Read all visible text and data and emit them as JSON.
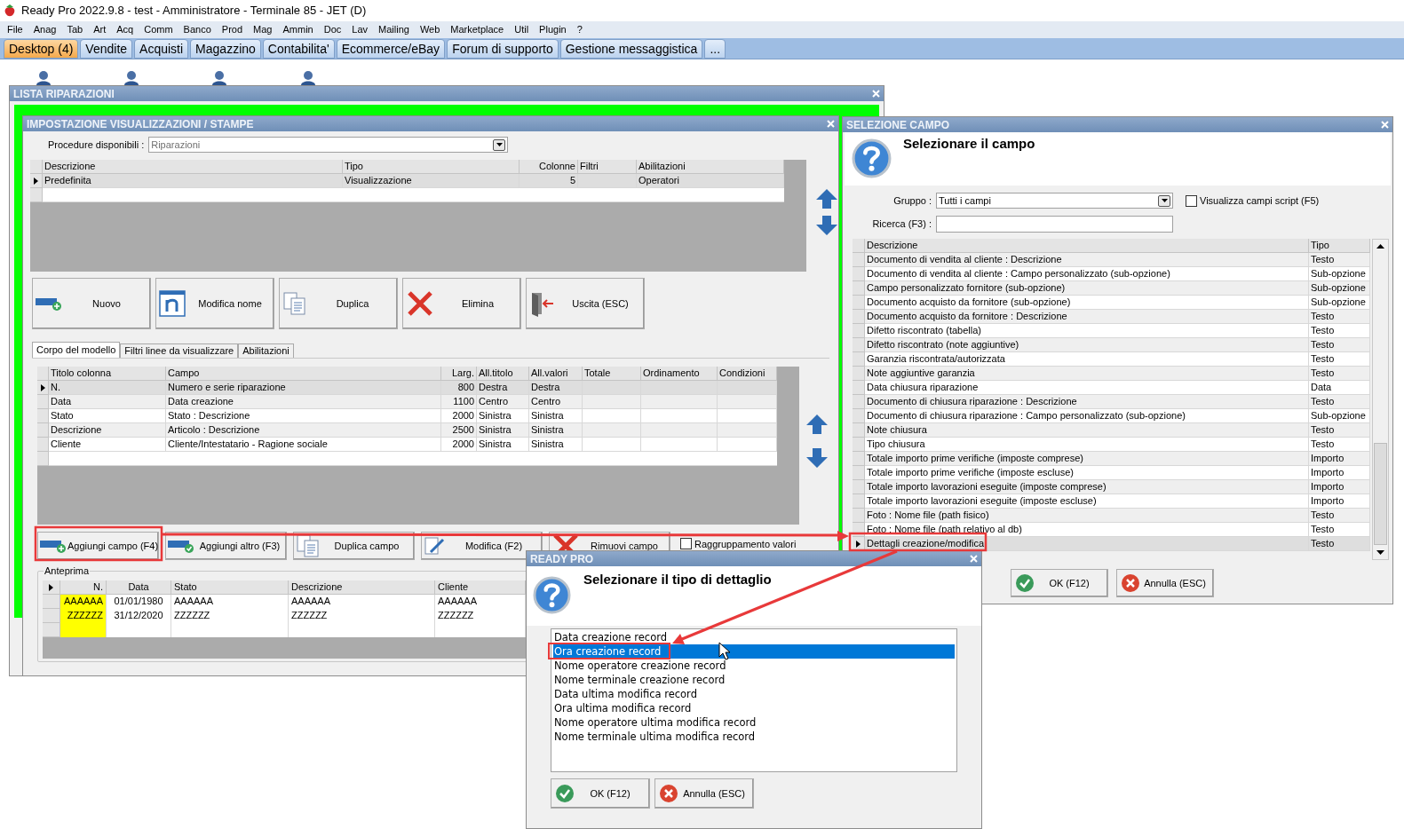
{
  "app": {
    "title": "Ready Pro 2022.9.8 - test - Amministratore - Terminale 85 - JET (D)"
  },
  "menu": [
    "File",
    "Anag",
    "Tab",
    "Art",
    "Acq",
    "Comm",
    "Banco",
    "Prod",
    "Mag",
    "Ammin",
    "Doc",
    "Lav",
    "Mailing",
    "Web",
    "Marketplace",
    "Util",
    "Plugin",
    "?"
  ],
  "tabs": [
    {
      "label": "Desktop (4)",
      "selected": true
    },
    {
      "label": "Vendite",
      "selected": false
    },
    {
      "label": "Acquisti",
      "selected": false
    },
    {
      "label": "Magazzino",
      "selected": false
    },
    {
      "label": "Contabilita'",
      "selected": false
    },
    {
      "label": "Ecommerce/eBay",
      "selected": false
    },
    {
      "label": "Forum di supporto",
      "selected": false
    },
    {
      "label": "Gestione messaggistica",
      "selected": false
    },
    {
      "label": "...",
      "selected": false
    }
  ],
  "lista_window": {
    "title": "LISTA RIPARAZIONI"
  },
  "impostazione": {
    "title": "IMPOSTAZIONE VISUALIZZAZIONI / STAMPE",
    "procedure_label": "Procedure disponibili :",
    "procedure_value": "Riparazioni",
    "models": {
      "columns": [
        "Descrizione",
        "Tipo",
        "Colonne",
        "Filtri",
        "Abilitazioni"
      ],
      "rows": [
        {
          "selected": true,
          "cells": [
            "Predefinita",
            "Visualizzazione",
            "5",
            "",
            "Operatori"
          ]
        }
      ]
    },
    "buttons": [
      {
        "kind": "new",
        "label": "Nuovo"
      },
      {
        "kind": "rename",
        "label": "Modifica nome"
      },
      {
        "kind": "duplicate",
        "label": "Duplica"
      },
      {
        "kind": "delete",
        "label": "Elimina"
      },
      {
        "kind": "exit",
        "label": "Uscita (ESC)"
      }
    ],
    "tabs": [
      {
        "label": "Corpo del modello",
        "selected": true
      },
      {
        "label": "Filtri linee da visualizzare",
        "selected": false
      },
      {
        "label": "Abilitazioni",
        "selected": false
      }
    ],
    "fields": {
      "columns": [
        "Titolo colonna",
        "Campo",
        "Larg.",
        "All.titolo",
        "All.valori",
        "Totale",
        "Ordinamento",
        "Condizioni"
      ],
      "rows": [
        {
          "selected": true,
          "cells": [
            "N.",
            "Numero e serie riparazione",
            "800",
            "Destra",
            "Destra",
            "",
            "",
            ""
          ]
        },
        {
          "selected": false,
          "cells": [
            "Data",
            "Data creazione",
            "1100",
            "Centro",
            "Centro",
            "",
            "",
            ""
          ]
        },
        {
          "selected": false,
          "cells": [
            "Stato",
            "Stato : Descrizione",
            "2000",
            "Sinistra",
            "Sinistra",
            "",
            "",
            ""
          ]
        },
        {
          "selected": false,
          "cells": [
            "Descrizione",
            "Articolo : Descrizione",
            "2500",
            "Sinistra",
            "Sinistra",
            "",
            "",
            ""
          ]
        },
        {
          "selected": false,
          "cells": [
            "Cliente",
            "Cliente/Intestatario - Ragione sociale",
            "2000",
            "Sinistra",
            "Sinistra",
            "",
            "",
            ""
          ]
        }
      ]
    },
    "field_buttons": [
      {
        "kind": "add",
        "label": "Aggiungi campo (F4)"
      },
      {
        "kind": "add_other",
        "label": "Aggiungi altro (F3)"
      },
      {
        "kind": "duplicate",
        "label": "Duplica campo"
      },
      {
        "kind": "edit",
        "label": "Modifica (F2)"
      },
      {
        "kind": "remove",
        "label": "Rimuovi campo"
      }
    ],
    "grouping": {
      "label": "Raggruppamento valori",
      "checked": false
    },
    "preview": {
      "title": "Anteprima",
      "columns": [
        "N.",
        "Data",
        "Stato",
        "Descrizione",
        "Cliente"
      ],
      "rows": [
        [
          "AAAAAA",
          "01/01/1980",
          "AAAAAA",
          "AAAAAA",
          "AAAAAA"
        ],
        [
          "ZZZZZZ",
          "31/12/2020",
          "ZZZZZZ",
          "ZZZZZZ",
          "ZZZZZZ"
        ]
      ]
    }
  },
  "selezione": {
    "title": "SELEZIONE CAMPO",
    "heading": "Selezionare il campo",
    "group_label": "Gruppo :",
    "group_value": "Tutti i campi",
    "script": {
      "label": "Visualizza campi script (F5)",
      "checked": false
    },
    "search_label": "Ricerca (F3) :",
    "columns": [
      "Descrizione",
      "Tipo"
    ],
    "rows": [
      {
        "selected": false,
        "descrizione": "Documento di vendita al cliente : Descrizione",
        "tipo": "Testo"
      },
      {
        "selected": false,
        "descrizione": "Documento di vendita al cliente : Campo personalizzato (sub-opzione)",
        "tipo": "Sub-opzione"
      },
      {
        "selected": false,
        "descrizione": "Campo personalizzato fornitore (sub-opzione)",
        "tipo": "Sub-opzione"
      },
      {
        "selected": false,
        "descrizione": "Documento acquisto da fornitore (sub-opzione)",
        "tipo": "Sub-opzione"
      },
      {
        "selected": false,
        "descrizione": "Documento acquisto da fornitore : Descrizione",
        "tipo": "Testo"
      },
      {
        "selected": false,
        "descrizione": "Difetto riscontrato (tabella)",
        "tipo": "Testo"
      },
      {
        "selected": false,
        "descrizione": "Difetto riscontrato (note aggiuntive)",
        "tipo": "Testo"
      },
      {
        "selected": false,
        "descrizione": "Garanzia riscontrata/autorizzata",
        "tipo": "Testo"
      },
      {
        "selected": false,
        "descrizione": "Note aggiuntive garanzia",
        "tipo": "Testo"
      },
      {
        "selected": false,
        "descrizione": "Data chiusura riparazione",
        "tipo": "Data"
      },
      {
        "selected": false,
        "descrizione": "Documento di chiusura riparazione : Descrizione",
        "tipo": "Testo"
      },
      {
        "selected": false,
        "descrizione": "Documento di chiusura riparazione : Campo personalizzato (sub-opzione)",
        "tipo": "Sub-opzione"
      },
      {
        "selected": false,
        "descrizione": "Note chiusura",
        "tipo": "Testo"
      },
      {
        "selected": false,
        "descrizione": "Tipo chiusura",
        "tipo": "Testo"
      },
      {
        "selected": false,
        "descrizione": "Totale importo prime verifiche (imposte comprese)",
        "tipo": "Importo"
      },
      {
        "selected": false,
        "descrizione": "Totale importo prime verifiche (imposte escluse)",
        "tipo": "Importo"
      },
      {
        "selected": false,
        "descrizione": "Totale importo lavorazioni eseguite (imposte comprese)",
        "tipo": "Importo"
      },
      {
        "selected": false,
        "descrizione": "Totale importo lavorazioni eseguite (imposte escluse)",
        "tipo": "Importo"
      },
      {
        "selected": false,
        "descrizione": "Foto : Nome file (path fisico)",
        "tipo": "Testo"
      },
      {
        "selected": false,
        "descrizione": "Foto : Nome file (path relativo al db)",
        "tipo": "Testo"
      },
      {
        "selected": true,
        "descrizione": "Dettagli creazione/modifica",
        "tipo": "Testo"
      }
    ],
    "buttons": [
      {
        "kind": "ok",
        "label": "OK (F12)"
      },
      {
        "kind": "cancel",
        "label": "Annulla (ESC)"
      }
    ]
  },
  "dettaglio": {
    "title": "READY PRO",
    "heading": "Selezionare il tipo di dettaglio",
    "options": [
      {
        "label": "Data creazione record",
        "selected": false
      },
      {
        "label": "Ora creazione record",
        "selected": true
      },
      {
        "label": "Nome operatore creazione record",
        "selected": false
      },
      {
        "label": "Nome terminale creazione record",
        "selected": false
      },
      {
        "label": "Data ultima modifica record",
        "selected": false
      },
      {
        "label": "Ora ultima modifica record",
        "selected": false
      },
      {
        "label": "Nome operatore ultima modifica record",
        "selected": false
      },
      {
        "label": "Nome terminale ultima modifica record",
        "selected": false
      }
    ],
    "buttons": [
      {
        "kind": "ok",
        "label": "OK (F12)"
      },
      {
        "kind": "cancel",
        "label": "Annulla (ESC)"
      }
    ]
  }
}
